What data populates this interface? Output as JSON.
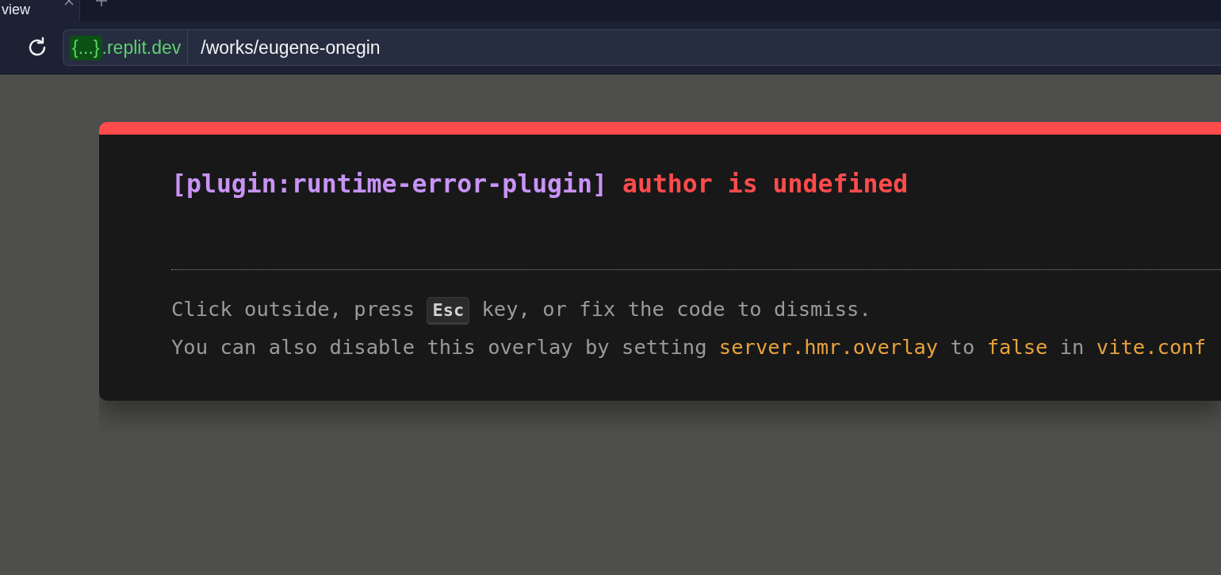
{
  "browser": {
    "tab": {
      "label": "view"
    },
    "address": {
      "host_badge": "{...}",
      "host": ".replit.dev",
      "path": "/works/eugene-onegin"
    }
  },
  "error_overlay": {
    "plugin": "[plugin:runtime-error-plugin]",
    "message": "author is undefined",
    "hint_line": {
      "before": "Click outside, press",
      "key": "Esc",
      "after": "key, or fix the code to dismiss."
    },
    "config_line": [
      {
        "kind": "text",
        "text": "You can also disable this overlay by setting "
      },
      {
        "kind": "code",
        "text": "server.hmr.overlay"
      },
      {
        "kind": "text",
        "text": " to "
      },
      {
        "kind": "code",
        "text": "false"
      },
      {
        "kind": "text",
        "text": " in "
      },
      {
        "kind": "code",
        "text": "vite.conf"
      }
    ]
  }
}
